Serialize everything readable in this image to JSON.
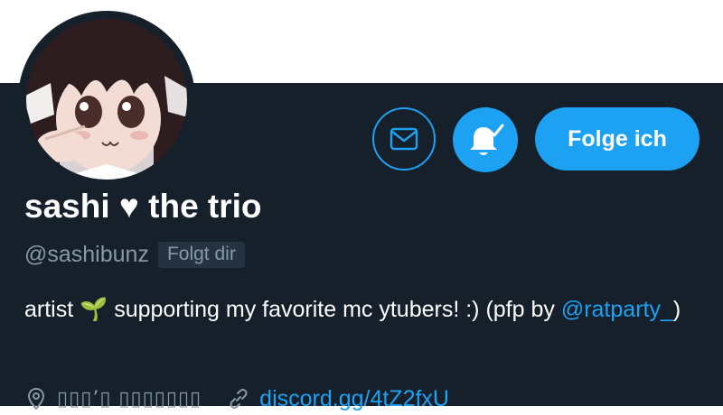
{
  "profile": {
    "display_name": "sashi ♥ the trio",
    "handle": "@sashibunz",
    "follows_you_badge": "Folgt dir",
    "bio": {
      "prefix": "artist 🌱 supporting my favorite mc ytubers! :) (pfp by ",
      "mention": "@ratparty_",
      "suffix": ")"
    },
    "location": "▯▯▯’▯ ▯▯▯▯▯▯▯",
    "website": "discord.gg/4tZ2fxU"
  },
  "actions": {
    "message_icon": "envelope-icon",
    "notify_icon": "bell-check-icon",
    "follow_label": "Folge ich"
  },
  "colors": {
    "background": "#15202b",
    "accent": "#1da1f2",
    "muted_text": "#8899a6",
    "header": "#ffffff"
  }
}
